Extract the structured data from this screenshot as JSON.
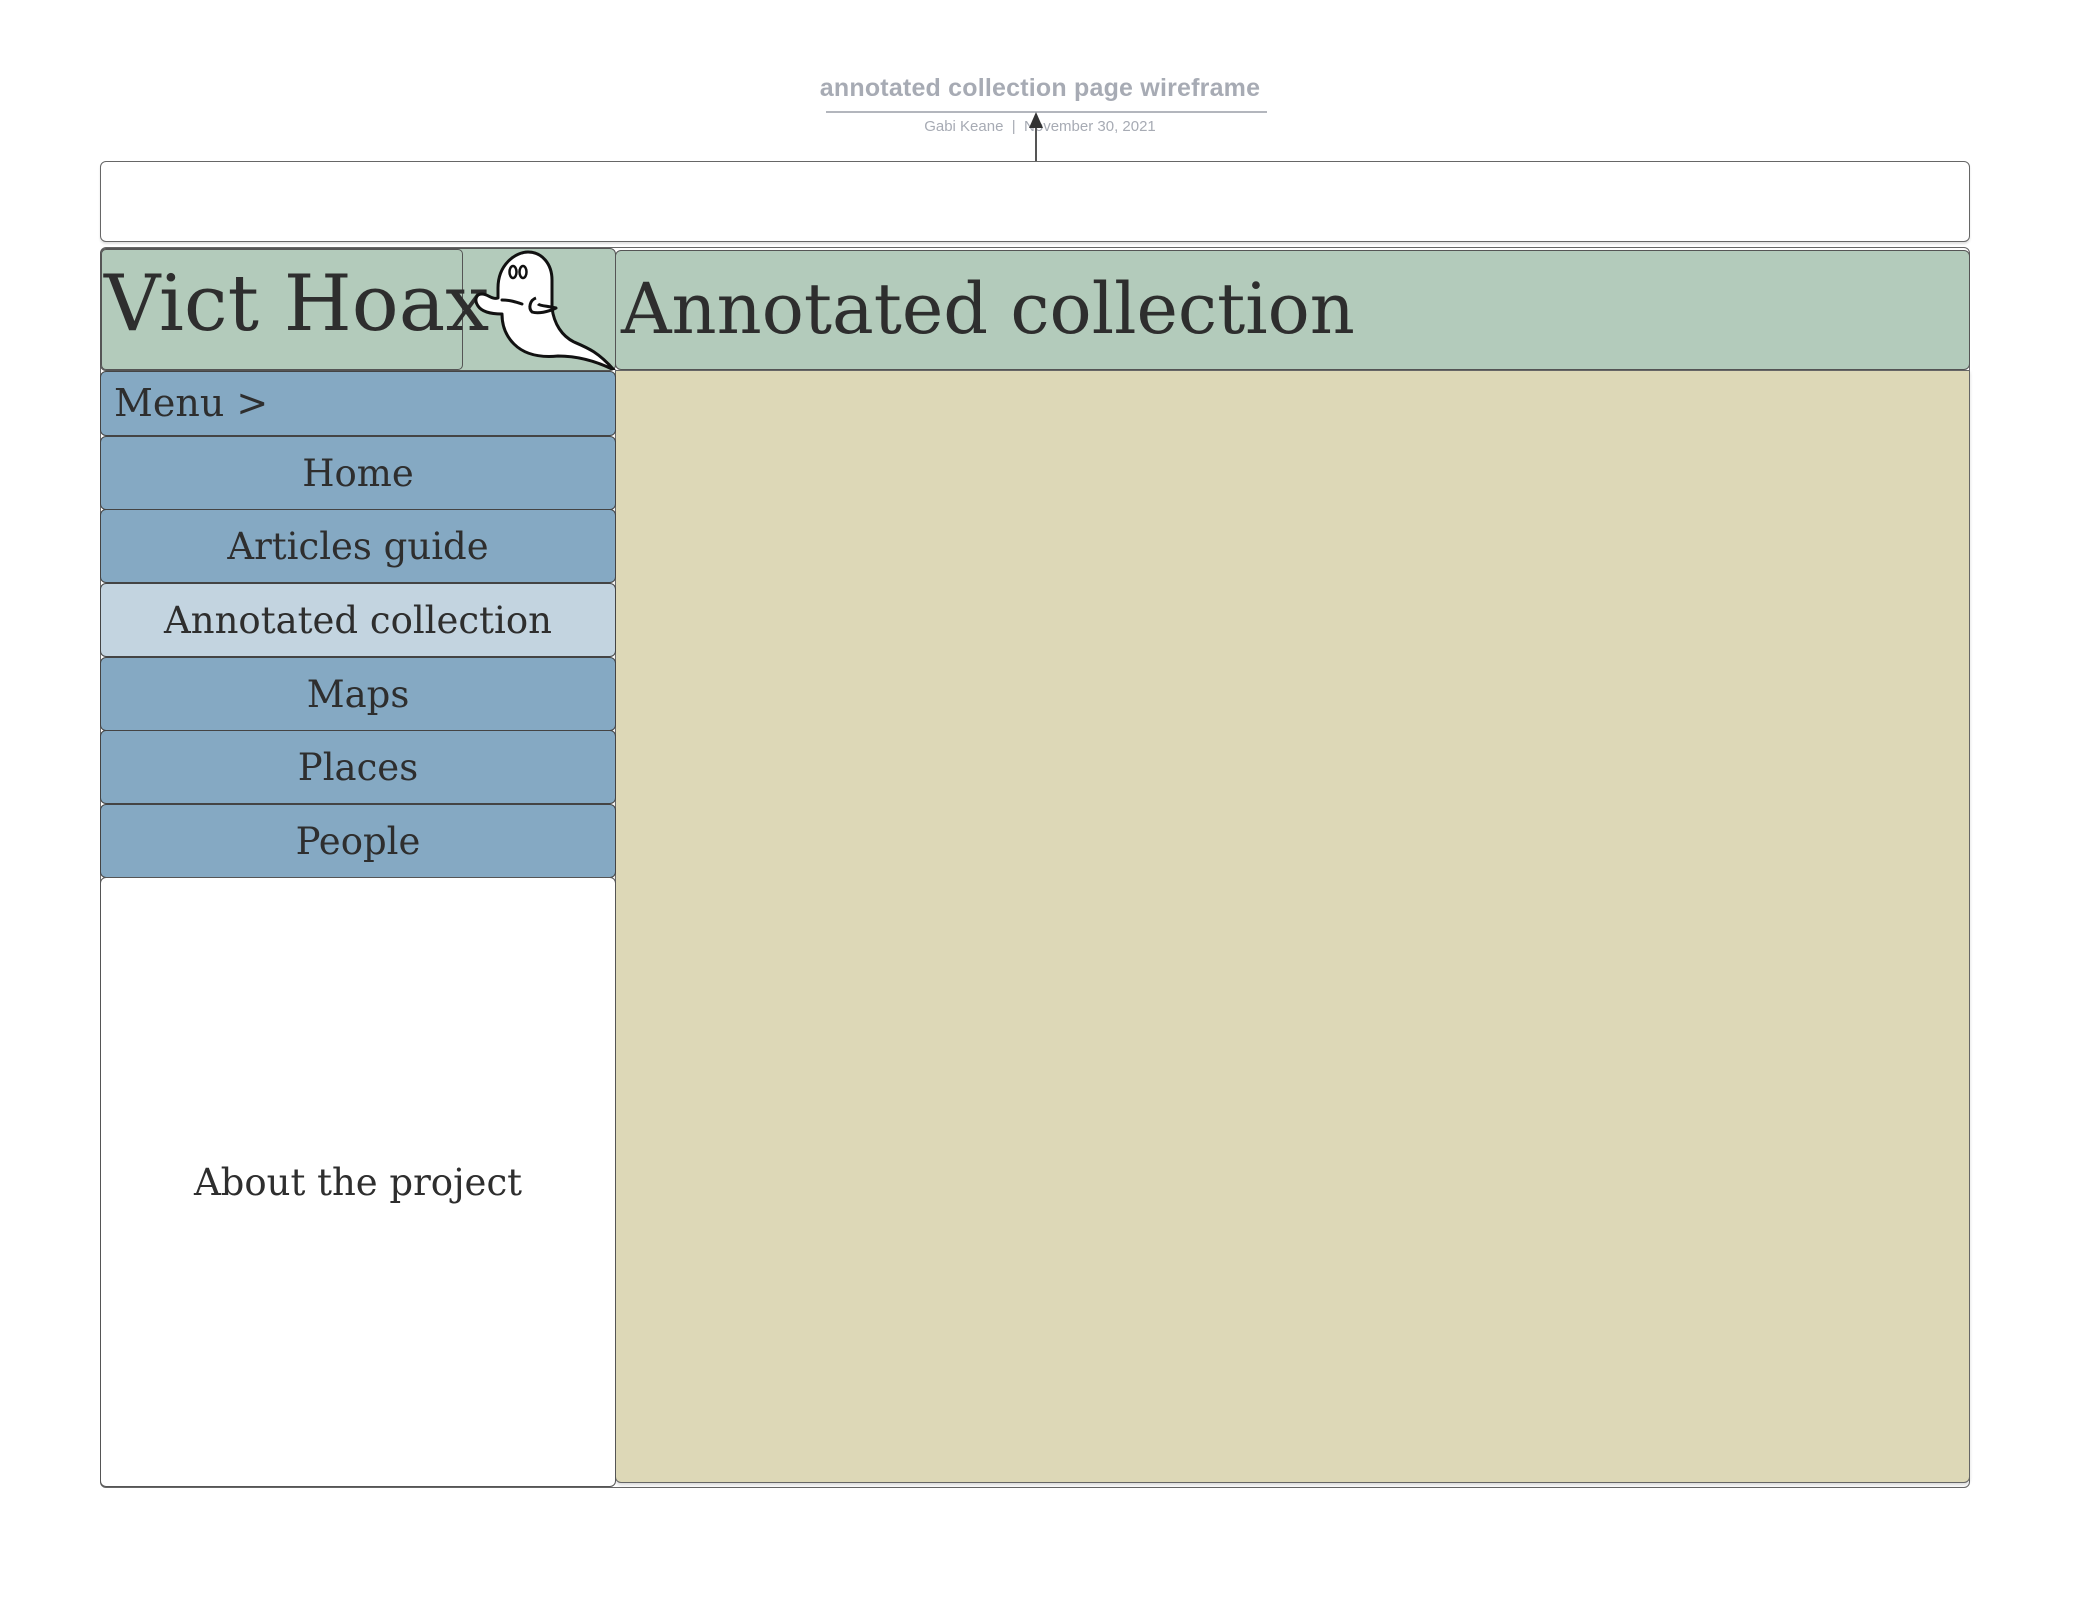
{
  "document": {
    "title": "annotated collection page wireframe",
    "author": "Gabi Keane",
    "separator": "|",
    "date": "November 30, 2021"
  },
  "site": {
    "logo_text": "Vict Hoax",
    "logo_icon": "ghost-icon"
  },
  "content": {
    "page_title": "Annotated collection"
  },
  "sidebar": {
    "menu_label": "Menu >",
    "items": [
      {
        "label": "Home",
        "active": false
      },
      {
        "label": "Articles guide",
        "active": false
      },
      {
        "label": "Annotated collection",
        "active": true
      },
      {
        "label": "Maps",
        "active": false
      },
      {
        "label": "Places",
        "active": false
      },
      {
        "label": "People",
        "active": false
      }
    ],
    "about_label": "About the project"
  },
  "colors": {
    "header_green": "#b3cbbb",
    "nav_blue": "#85a9c3",
    "nav_active": "#c3d4e0",
    "content_tan": "#ddd8b7",
    "title_gray": "#a7abb4"
  }
}
